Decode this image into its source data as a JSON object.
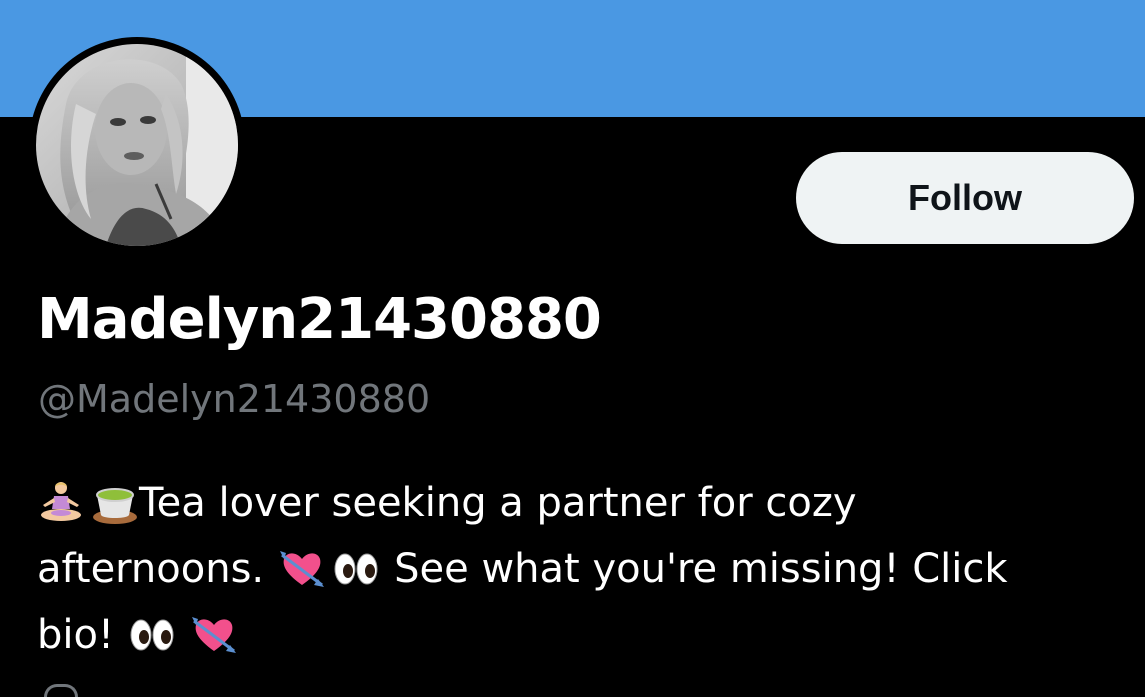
{
  "header": {
    "banner_color": "#4a98e3"
  },
  "profile": {
    "display_name": "Madelyn21430880",
    "handle": "@Madelyn21430880",
    "follow_label": "Follow",
    "avatar_icon": "profile-photo"
  },
  "bio": {
    "emoji": [
      "yoga-person-emoji",
      "tea-cup-emoji",
      "heart-arrow-emoji",
      "eyes-emoji"
    ],
    "line1_text": "Tea lover seeking a partner for cozy",
    "line2_text_a": "afternoons.",
    "line2_text_b": "See what you're missing! Click",
    "line3_text": "bio!"
  },
  "colors": {
    "background": "#000000",
    "primary_text": "#ffffff",
    "secondary_text": "#71767b",
    "follow_button_bg": "#eff3f4",
    "follow_button_text": "#0f1419"
  }
}
